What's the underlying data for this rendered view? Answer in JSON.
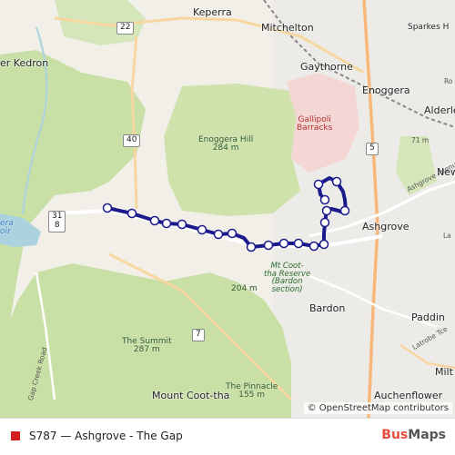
{
  "map": {
    "route_color": "#1a1a8c",
    "stop_fill": "#ffffff",
    "suburbs": {
      "keperra": "Keperra",
      "mitchelton": "Mitchelton",
      "gaythorne": "Gaythorne",
      "enoggera": "Enoggera",
      "alderley": "Alderle",
      "kedron": "er Kedron",
      "ashgrove": "Ashgrove",
      "bardon": "Bardon",
      "paddington": "Paddin",
      "auchenflower": "Auchenflower",
      "milton": "Milt",
      "newmarket": "New",
      "sparkes": "Sparkes H"
    },
    "features": {
      "enoggera_hill_name": "Enoggera Hill",
      "enoggera_hill_elev": "284 m",
      "barracks_1": "Gallipoli",
      "barracks_2": "Barracks",
      "peak_204": "204 m",
      "summit_name": "The Summit",
      "summit_elev": "287 m",
      "mt_cootha": "Mount Coot-tha",
      "pinnacle_name": "The Pinnacle",
      "pinnacle_elev": "155 m",
      "reserve_1": "Mt Coot-",
      "reserve_2": "tha Reserve",
      "reserve_3": "(Bardon",
      "reserve_4": "section)",
      "spot_71": "71 m",
      "reservoir_1": "era",
      "reservoir_2": "oir"
    },
    "shields": {
      "s22": "22",
      "s40": "40",
      "s31_top": "31",
      "s31_bottom": "8",
      "s5": "5",
      "s7": "7"
    },
    "roads": {
      "ashgrove_avenue": "Ashgrove Avenue",
      "gap_creek_road": "Gap Creek Road",
      "latrobe_tce": "Latrobe Tce",
      "lr": "La",
      "ro": "Ro"
    },
    "attribution": "© OpenStreetMap contributors"
  },
  "legend": {
    "swatch_color": "#d21f1f",
    "route_label": "S787 — Ashgrove - The Gap"
  },
  "brand": {
    "part1": "Bus",
    "part2": "Maps"
  }
}
